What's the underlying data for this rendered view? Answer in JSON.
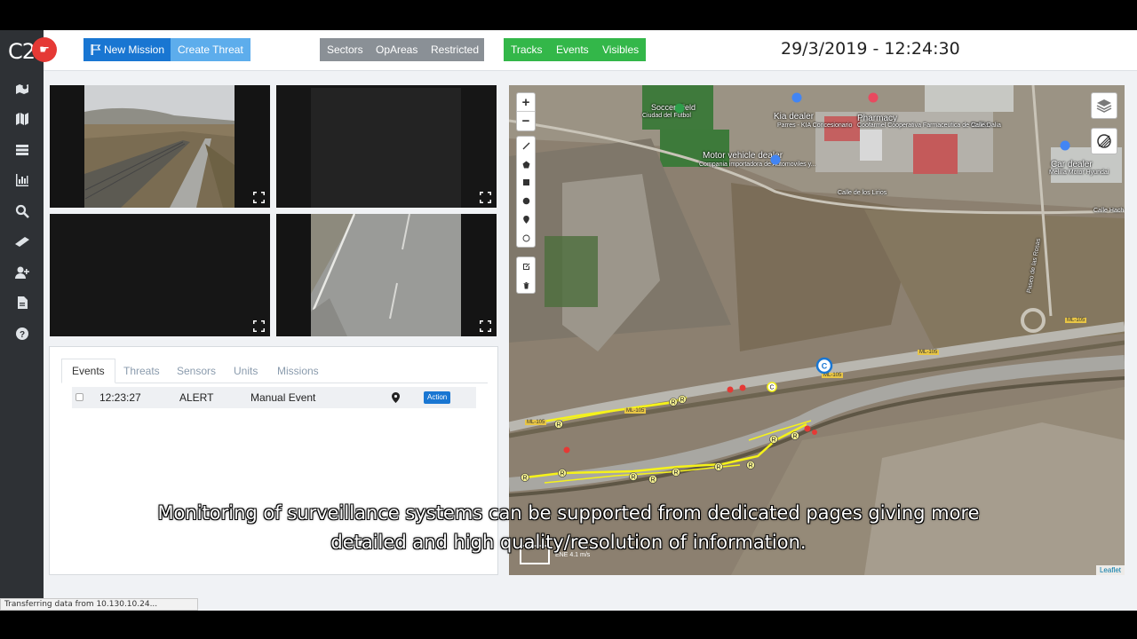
{
  "app": {
    "logo_text": "C2"
  },
  "topbar": {
    "new_mission": "New Mission",
    "create_threat": "Create Threat",
    "sectors": "Sectors",
    "opareas": "OpAreas",
    "restricted": "Restricted",
    "tracks": "Tracks",
    "events": "Events",
    "visibles": "Visibles",
    "datetime": "29/3/2019 - 12:24:30"
  },
  "sidebar": {
    "icons": [
      "map-marker-icon",
      "map-icon",
      "list-icon",
      "chart-icon",
      "search-icon",
      "ruler-icon",
      "user-plus-icon",
      "document-icon",
      "help-icon"
    ]
  },
  "cameras": [
    {
      "id": "cam1",
      "content": "road-fence-feed"
    },
    {
      "id": "cam2",
      "content": "dark-feed"
    },
    {
      "id": "cam3",
      "content": "dark-feed"
    },
    {
      "id": "cam4",
      "content": "road-closeup-feed"
    }
  ],
  "events_panel": {
    "tabs": [
      "Events",
      "Threats",
      "Sensors",
      "Units",
      "Missions"
    ],
    "active_tab": "Events",
    "rows": [
      {
        "time": "12:23:27",
        "type": "ALERT",
        "description": "Manual Event",
        "action": "Action"
      }
    ]
  },
  "map": {
    "labels": {
      "soccer": "Soccer Field",
      "soccer_sub": "Ciudad del Futbol",
      "kia": "Kia dealer",
      "kia_sub": "Parres - KIA Concesionario",
      "pharmacy": "Pharmacy",
      "pharmacy_sub": "Coofarmel Cooperativa Farmaceutica de Melilla",
      "motor": "Motor vehicle dealer",
      "motor_sub": "Compania importadora de Automoviles y...",
      "cardealer": "Car dealer",
      "cardealer_sub": "Melilla Motor Hyundai",
      "lirios": "Calle de los Lirios",
      "dalia": "Calle Dalia",
      "hach": "Calle Hach",
      "rosas": "Paseo de las Rosas",
      "ml105a": "ML-105",
      "ml105b": "ML-105",
      "ml105c": "ML-105",
      "ml105d": "ML-105",
      "ml105e": "ML-105"
    },
    "wind": "ENE 4.1 m/s",
    "attribution": "Leaflet",
    "zoom_in": "+",
    "zoom_out": "−"
  },
  "status_bar": "Transferring data from 10.130.10.24...",
  "caption": {
    "line1": "Monitoring of surveillance systems can be supported from dedicated pages giving more",
    "line2": "detailed and high quality/resolution of information."
  },
  "colors": {
    "rail": "#2e3135",
    "primary": "#1976d2",
    "green": "#33b749",
    "grey": "#8a9096",
    "track": "#f5f21a",
    "alert": "#e53935"
  }
}
